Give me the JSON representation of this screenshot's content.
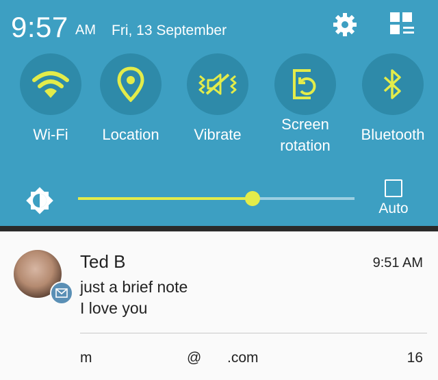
{
  "status": {
    "time": "9:57",
    "ampm": "AM",
    "date": "Fri, 13 September"
  },
  "header_icons": [
    "gear-icon",
    "grid-edit-icon"
  ],
  "quick_settings": [
    {
      "label": "Wi-Fi",
      "icon": "wifi-icon"
    },
    {
      "label": "Location",
      "icon": "location-pin-icon"
    },
    {
      "label": "Vibrate",
      "icon": "vibrate-icon"
    },
    {
      "label_line1": "Screen",
      "label_line2": "rotation",
      "icon": "screen-rotation-icon"
    },
    {
      "label": "Bluetooth",
      "icon": "bluetooth-icon"
    }
  ],
  "brightness": {
    "level": 0.63,
    "auto_label": "Auto",
    "auto_checked": false
  },
  "notification": {
    "sender": "Ted B",
    "time": "9:51 AM",
    "subject": "just a brief note",
    "body": "I love you",
    "account_parts": [
      "m",
      "@",
      ".com"
    ],
    "count": "16"
  },
  "colors": {
    "panel": "#3d9fc2",
    "tile": "#2e8aa9",
    "accent": "#e3ec4a",
    "text": "#222222"
  }
}
